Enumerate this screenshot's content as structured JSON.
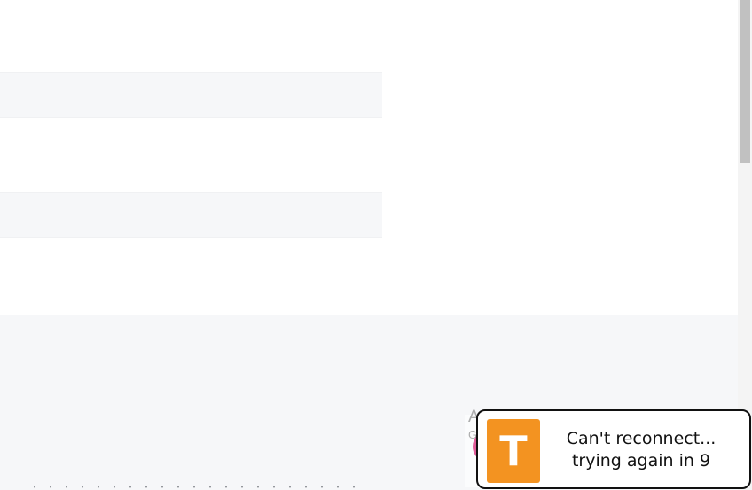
{
  "app_logo": {
    "letter": "T",
    "color": "#f39321"
  },
  "reconnect_toast": {
    "line1": "Can't reconnect...",
    "line2": "trying again in 9"
  },
  "os_watermark": {
    "title": "Activate Windows",
    "subtitle": "Go to Settings to activate Windows."
  },
  "colors": {
    "page_background": "#ffffff",
    "stripe_background": "#f6f7f9",
    "toast_border": "#111111"
  }
}
